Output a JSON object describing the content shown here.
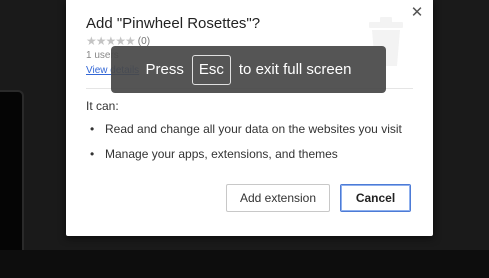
{
  "dialog": {
    "title": "Add \"Pinwheel Rosettes\"?",
    "close_glyph": "✕",
    "stars": "★★★★★",
    "rating_count": "(0)",
    "users": "1 users",
    "details_link": "View details",
    "intro": "It can:",
    "permissions": [
      "Read and change all your data on the websites you visit",
      "Manage your apps, extensions, and themes"
    ],
    "add_button": "Add extension",
    "cancel_button": "Cancel",
    "icon": "extension-trash-icon"
  },
  "fullscreen_toast": {
    "before": "Press",
    "key": "Esc",
    "after": "to exit full screen"
  },
  "colors": {
    "accent": "#4d7bd6",
    "link": "#3367d6",
    "toast_bg": "#484848"
  }
}
